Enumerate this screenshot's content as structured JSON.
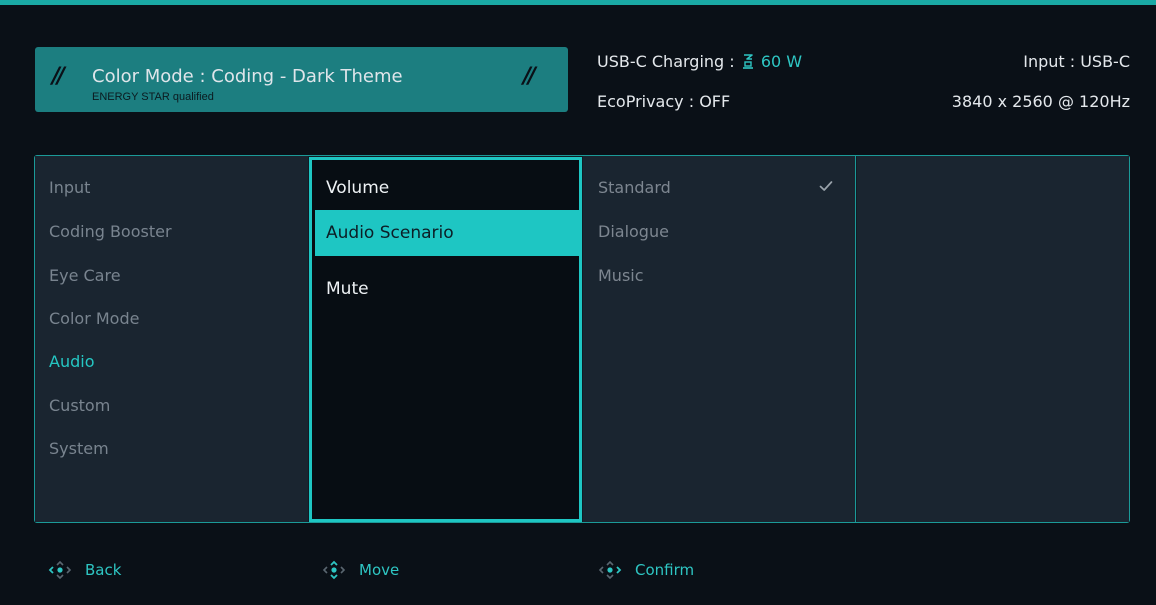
{
  "header": {
    "color_mode_label": "Color Mode : Coding - Dark Theme",
    "energy_label": "ENERGY STAR qualified",
    "usb_charging_label": "USB-C Charging :",
    "usb_charging_value": "60 W",
    "eco_privacy": "EcoPrivacy : OFF",
    "input": "Input : USB-C",
    "resolution": "3840 x 2560 @ 120Hz"
  },
  "menu": {
    "main_items": [
      {
        "label": "Input"
      },
      {
        "label": "Coding Booster"
      },
      {
        "label": "Eye Care"
      },
      {
        "label": "Color Mode"
      },
      {
        "label": "Audio",
        "active": true
      },
      {
        "label": "Custom"
      },
      {
        "label": "System"
      }
    ],
    "sub_items": [
      {
        "label": "Volume"
      },
      {
        "label": "Audio Scenario",
        "selected": true
      },
      {
        "label": "Mute"
      }
    ],
    "options": [
      {
        "label": "Standard",
        "checked": true
      },
      {
        "label": "Dialogue"
      },
      {
        "label": "Music"
      }
    ]
  },
  "footer": {
    "back": "Back",
    "move": "Move",
    "confirm": "Confirm"
  },
  "icons": {
    "plug": "usb-plug-icon",
    "check": "check-icon",
    "joystick": "joystick-icon"
  },
  "colors": {
    "accent": "#1ec6c3",
    "badge": "#1c7e80",
    "background": "#0a1017",
    "panel": "#1a2530",
    "muted_text": "#79848f"
  }
}
